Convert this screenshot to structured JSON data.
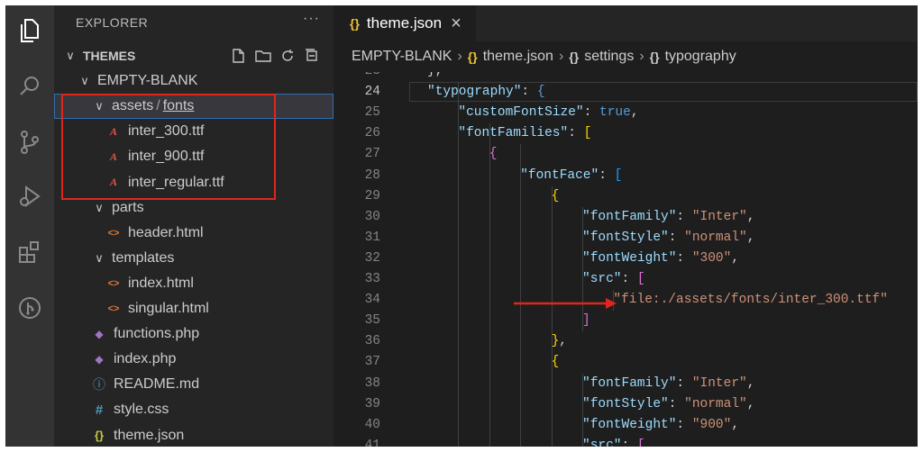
{
  "sidebar": {
    "title": "EXPLORER",
    "more": "···",
    "tree": [
      {
        "label": "THEMES",
        "chev": "∨",
        "indent": 0,
        "icon": "",
        "bold": true,
        "name": "tree-root-themes"
      },
      {
        "label": "EMPTY-BLANK",
        "chev": "∨",
        "indent": 1,
        "icon": "",
        "name": "tree-folder-empty-blank"
      },
      {
        "label": "assets",
        "label2": "fonts",
        "chev": "∨",
        "indent": 2,
        "icon": "",
        "selected": true,
        "name": "tree-folder-assets-fonts"
      },
      {
        "label": "inter_300.ttf",
        "indent": 3,
        "icon": "font",
        "name": "tree-file-inter-300"
      },
      {
        "label": "inter_900.ttf",
        "indent": 3,
        "icon": "font",
        "name": "tree-file-inter-900"
      },
      {
        "label": "inter_regular.ttf",
        "indent": 3,
        "icon": "font",
        "name": "tree-file-inter-regular"
      },
      {
        "label": "parts",
        "chev": "∨",
        "indent": 2,
        "icon": "",
        "name": "tree-folder-parts"
      },
      {
        "label": "header.html",
        "indent": 3,
        "icon": "html",
        "name": "tree-file-header-html"
      },
      {
        "label": "templates",
        "chev": "∨",
        "indent": 2,
        "icon": "",
        "name": "tree-folder-templates"
      },
      {
        "label": "index.html",
        "indent": 3,
        "icon": "html",
        "name": "tree-file-index-html"
      },
      {
        "label": "singular.html",
        "indent": 3,
        "icon": "html",
        "name": "tree-file-singular-html"
      },
      {
        "label": "functions.php",
        "indent": 2,
        "icon": "php",
        "name": "tree-file-functions-php"
      },
      {
        "label": "index.php",
        "indent": 2,
        "icon": "php",
        "name": "tree-file-index-php"
      },
      {
        "label": "README.md",
        "indent": 2,
        "icon": "info",
        "name": "tree-file-readme"
      },
      {
        "label": "style.css",
        "indent": 2,
        "icon": "css",
        "name": "tree-file-style-css"
      },
      {
        "label": "theme.json",
        "indent": 2,
        "icon": "json",
        "name": "tree-file-theme-json"
      }
    ]
  },
  "editor": {
    "tab": {
      "icon": "{}",
      "label": "theme.json",
      "close": "×"
    },
    "breadcrumbs": [
      {
        "text": "EMPTY-BLANK",
        "icon": ""
      },
      {
        "text": "theme.json",
        "icon": "{}"
      },
      {
        "text": "settings",
        "icon": "{}"
      },
      {
        "text": "typography",
        "icon": "{}"
      }
    ],
    "current_line": "24",
    "lines": [
      {
        "n": "23",
        "ind": 1,
        "t": [
          {
            "c": "p",
            "v": "},"
          }
        ]
      },
      {
        "n": "24",
        "ind": 1,
        "t": [
          {
            "c": "k",
            "v": "\"typography\""
          },
          {
            "c": "p",
            "v": ": "
          },
          {
            "c": "b",
            "v": "{"
          }
        ]
      },
      {
        "n": "25",
        "ind": 2,
        "t": [
          {
            "c": "k",
            "v": "\"customFontSize\""
          },
          {
            "c": "p",
            "v": ": "
          },
          {
            "c": "b",
            "v": "true"
          },
          {
            "c": "p",
            "v": ","
          }
        ]
      },
      {
        "n": "26",
        "ind": 2,
        "t": [
          {
            "c": "k",
            "v": "\"fontFamilies\""
          },
          {
            "c": "p",
            "v": ": "
          },
          {
            "c": "y",
            "v": "["
          }
        ]
      },
      {
        "n": "27",
        "ind": 3,
        "t": [
          {
            "c": "m",
            "v": "{"
          }
        ]
      },
      {
        "n": "28",
        "ind": 4,
        "t": [
          {
            "c": "k",
            "v": "\"fontFace\""
          },
          {
            "c": "p",
            "v": ": "
          },
          {
            "c": "c",
            "v": "["
          }
        ]
      },
      {
        "n": "29",
        "ind": 5,
        "t": [
          {
            "c": "y",
            "v": "{"
          }
        ]
      },
      {
        "n": "30",
        "ind": 6,
        "t": [
          {
            "c": "k",
            "v": "\"fontFamily\""
          },
          {
            "c": "p",
            "v": ": "
          },
          {
            "c": "s",
            "v": "\"Inter\""
          },
          {
            "c": "p",
            "v": ","
          }
        ]
      },
      {
        "n": "31",
        "ind": 6,
        "t": [
          {
            "c": "k",
            "v": "\"fontStyle\""
          },
          {
            "c": "p",
            "v": ": "
          },
          {
            "c": "s",
            "v": "\"normal\""
          },
          {
            "c": "p",
            "v": ","
          }
        ]
      },
      {
        "n": "32",
        "ind": 6,
        "t": [
          {
            "c": "k",
            "v": "\"fontWeight\""
          },
          {
            "c": "p",
            "v": ": "
          },
          {
            "c": "s",
            "v": "\"300\""
          },
          {
            "c": "p",
            "v": ","
          }
        ]
      },
      {
        "n": "33",
        "ind": 6,
        "t": [
          {
            "c": "k",
            "v": "\"src\""
          },
          {
            "c": "p",
            "v": ": "
          },
          {
            "c": "m",
            "v": "["
          }
        ]
      },
      {
        "n": "34",
        "ind": 7,
        "t": [
          {
            "c": "s",
            "v": "\"file:./assets/fonts/inter_300.ttf\""
          }
        ]
      },
      {
        "n": "35",
        "ind": 6,
        "t": [
          {
            "c": "m",
            "v": "]"
          }
        ]
      },
      {
        "n": "36",
        "ind": 5,
        "t": [
          {
            "c": "y",
            "v": "}"
          },
          {
            "c": "p",
            "v": ","
          }
        ]
      },
      {
        "n": "37",
        "ind": 5,
        "t": [
          {
            "c": "y",
            "v": "{"
          }
        ]
      },
      {
        "n": "38",
        "ind": 6,
        "t": [
          {
            "c": "k",
            "v": "\"fontFamily\""
          },
          {
            "c": "p",
            "v": ": "
          },
          {
            "c": "s",
            "v": "\"Inter\""
          },
          {
            "c": "p",
            "v": ","
          }
        ]
      },
      {
        "n": "39",
        "ind": 6,
        "t": [
          {
            "c": "k",
            "v": "\"fontStyle\""
          },
          {
            "c": "p",
            "v": ": "
          },
          {
            "c": "s",
            "v": "\"normal\""
          },
          {
            "c": "p",
            "v": ","
          }
        ]
      },
      {
        "n": "40",
        "ind": 6,
        "t": [
          {
            "c": "k",
            "v": "\"fontWeight\""
          },
          {
            "c": "p",
            "v": ": "
          },
          {
            "c": "s",
            "v": "\"900\""
          },
          {
            "c": "p",
            "v": ","
          }
        ]
      },
      {
        "n": "41",
        "ind": 6,
        "t": [
          {
            "c": "k",
            "v": "\"src\""
          },
          {
            "c": "p",
            "v": ": "
          },
          {
            "c": "m",
            "v": "["
          }
        ]
      }
    ]
  },
  "annotations": {
    "highlight_color": "#e0261c"
  },
  "colors": {
    "sidebar_bg": "#252526",
    "editor_bg": "#1e1e1e",
    "activity_bg": "#333333",
    "selection_border": "#2f6fb3"
  }
}
